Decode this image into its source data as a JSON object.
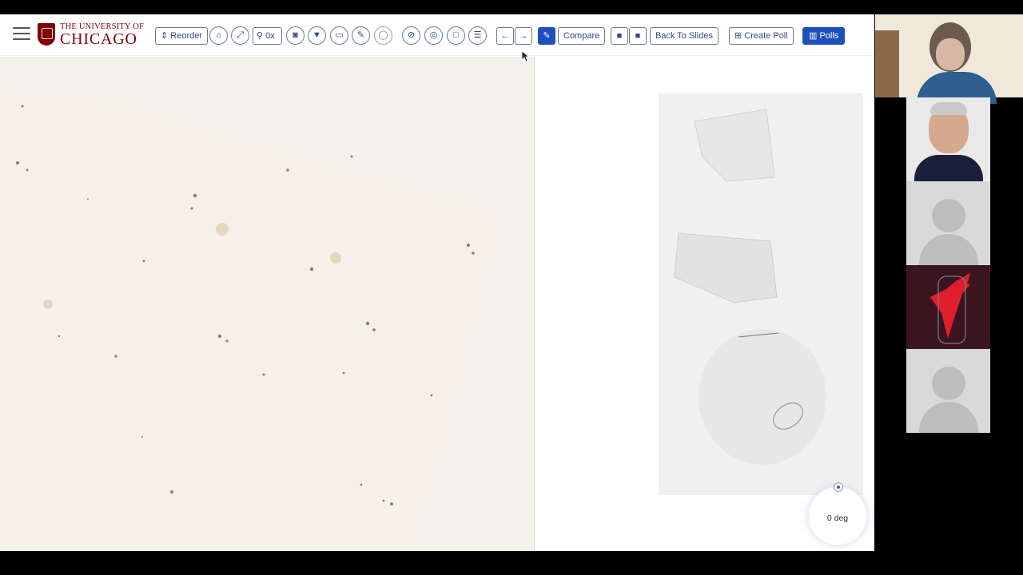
{
  "brand": {
    "line1": "THE UNIVERSITY OF",
    "line2": "CHICAGO",
    "primary_color": "#800000"
  },
  "toolbar": {
    "reorder_label": "Reorder",
    "zoom_label": "0x",
    "compare_label": "Compare",
    "back_label": "Back To Slides",
    "create_poll_label": "Create Poll",
    "polls_label": "Polls",
    "accent_color": "#1f4fbf"
  },
  "viewer": {
    "rotation_label": "0 deg"
  },
  "icons": {
    "menu": "hamburger-icon",
    "home": "home-icon",
    "fit": "expand-icon",
    "zoom": "magnifier-icon",
    "camera": "camera-icon",
    "filter": "filter-icon",
    "present": "monitor-icon",
    "pen": "pencil-icon",
    "lasso": "lasso-icon",
    "record": "video-camera-icon",
    "stop": "stop-icon",
    "poll": "bar-chart-icon"
  }
}
